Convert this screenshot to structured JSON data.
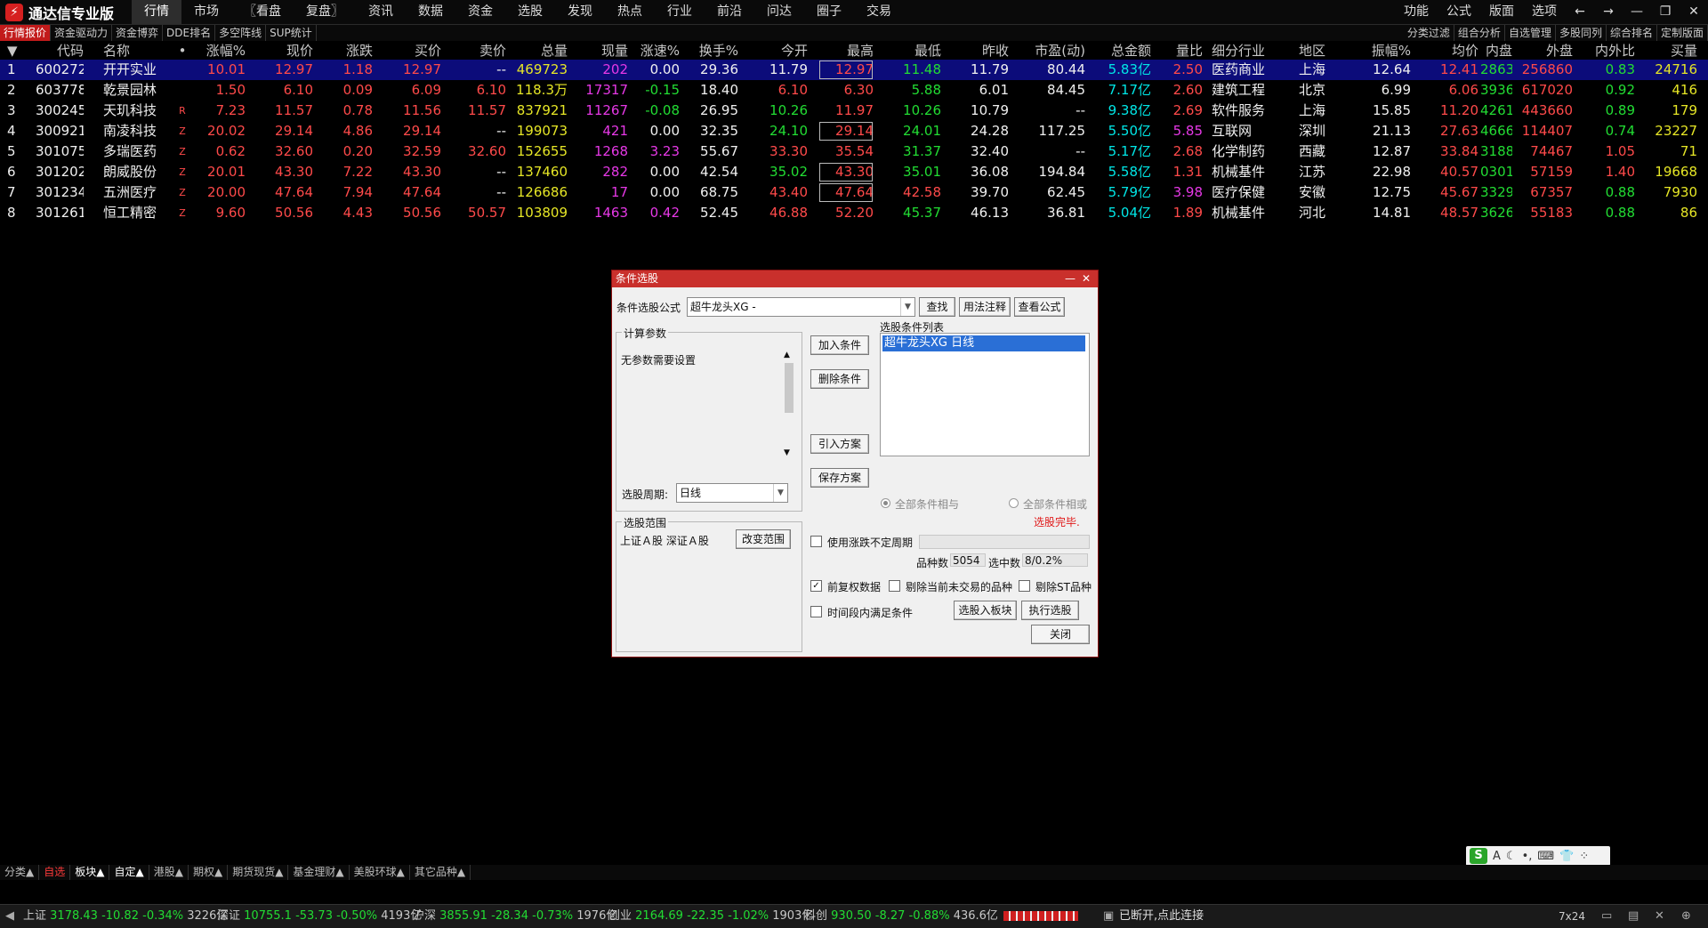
{
  "app": {
    "title": "通达信专业版",
    "menu": [
      "行情",
      "市场",
      "〖看盘",
      "复盘〗",
      "资讯",
      "数据",
      "资金",
      "选股",
      "发现",
      "热点",
      "行业",
      "前沿",
      "问达",
      "圈子",
      "交易"
    ],
    "right_menu": [
      "功能",
      "公式",
      "版面",
      "选项"
    ],
    "window_icons": [
      "back-arrow-icon",
      "forward-arrow-icon",
      "minimize-icon",
      "restore-icon",
      "close-icon"
    ]
  },
  "subtabs_left": [
    "行情报价",
    "资金驱动力",
    "资金博弈",
    "DDE排名",
    "多空阵线",
    "SUP统计"
  ],
  "subtabs_right": [
    "分类过滤",
    "组合分析",
    "自选管理",
    "多股同列",
    "综合排名",
    "定制版面"
  ],
  "table": {
    "columns": [
      "",
      "代码",
      "名称",
      "•",
      "涨幅%",
      "现价",
      "涨跌",
      "买价",
      "卖价",
      "总量",
      "现量",
      "涨速%",
      "换手%",
      "今开",
      "最高",
      "最低",
      "昨收",
      "市盈(动)",
      "总金额",
      "量比",
      "细分行业",
      "地区",
      "振幅%",
      "均价",
      "内盘",
      "外盘",
      "内外比",
      "买量"
    ],
    "rows": [
      [
        "1",
        "600272",
        "开开实业",
        "",
        "10.01",
        "12.97",
        "1.18",
        "12.97",
        "--",
        "469723",
        "202",
        "0.00",
        "29.36",
        "11.79",
        "12.97",
        "11.48",
        "11.79",
        "80.44",
        "5.83亿",
        "2.50",
        "医药商业",
        "上海",
        "12.64",
        "12.41",
        "2863",
        "256860",
        "0.83",
        "24716"
      ],
      [
        "2",
        "603778",
        "乾景园林",
        "",
        "1.50",
        "6.10",
        "0.09",
        "6.09",
        "6.10",
        "118.3万",
        "17317",
        "-0.15",
        "18.40",
        "6.10",
        "6.30",
        "5.88",
        "6.01",
        "84.45",
        "7.17亿",
        "2.60",
        "建筑工程",
        "北京",
        "6.99",
        "6.06",
        "3936",
        "617020",
        "0.92",
        "416"
      ],
      [
        "3",
        "300245",
        "天玑科技",
        "R",
        "7.23",
        "11.57",
        "0.78",
        "11.56",
        "11.57",
        "837921",
        "11267",
        "-0.08",
        "26.95",
        "10.26",
        "11.97",
        "10.26",
        "10.79",
        "--",
        "9.38亿",
        "2.69",
        "软件服务",
        "上海",
        "15.85",
        "11.20",
        "4261",
        "443660",
        "0.89",
        "179"
      ],
      [
        "4",
        "300921",
        "南凌科技",
        "Z",
        "20.02",
        "29.14",
        "4.86",
        "29.14",
        "--",
        "199073",
        "421",
        "0.00",
        "32.35",
        "24.10",
        "29.14",
        "24.01",
        "24.28",
        "117.25",
        "5.50亿",
        "5.85",
        "互联网",
        "深圳",
        "21.13",
        "27.63",
        "4666",
        "114407",
        "0.74",
        "23227"
      ],
      [
        "5",
        "301075",
        "多瑞医药",
        "Z",
        "0.62",
        "32.60",
        "0.20",
        "32.59",
        "32.60",
        "152655",
        "1268",
        "3.23",
        "55.67",
        "33.30",
        "35.54",
        "31.37",
        "32.40",
        "--",
        "5.17亿",
        "2.68",
        "化学制药",
        "西藏",
        "12.87",
        "33.84",
        "3188",
        "74467",
        "1.05",
        "71"
      ],
      [
        "6",
        "301202",
        "朗威股份",
        "Z",
        "20.01",
        "43.30",
        "7.22",
        "43.30",
        "--",
        "137460",
        "282",
        "0.00",
        "42.54",
        "35.02",
        "43.30",
        "35.01",
        "36.08",
        "194.84",
        "5.58亿",
        "1.31",
        "机械基件",
        "江苏",
        "22.98",
        "40.57",
        "0301",
        "57159",
        "1.40",
        "19668"
      ],
      [
        "7",
        "301234",
        "五洲医疗",
        "Z",
        "20.00",
        "47.64",
        "7.94",
        "47.64",
        "--",
        "126686",
        "17",
        "0.00",
        "68.75",
        "43.40",
        "47.64",
        "42.58",
        "39.70",
        "62.45",
        "5.79亿",
        "3.98",
        "医疗保健",
        "安徽",
        "12.75",
        "45.67",
        "3329",
        "67357",
        "0.88",
        "7930"
      ],
      [
        "8",
        "301261",
        "恒工精密",
        "Z",
        "9.60",
        "50.56",
        "4.43",
        "50.56",
        "50.57",
        "103809",
        "1463",
        "0.42",
        "52.45",
        "46.88",
        "52.20",
        "45.37",
        "46.13",
        "36.81",
        "5.04亿",
        "1.89",
        "机械基件",
        "河北",
        "14.81",
        "48.57",
        "3626",
        "55183",
        "0.88",
        "86"
      ]
    ]
  },
  "bottom_tabs": [
    "分类▲",
    "自选",
    "板块▲",
    "自定▲",
    "港股▲",
    "期权▲",
    "期货现货▲",
    "基金理财▲",
    "美股环球▲",
    "其它品种▲"
  ],
  "status": {
    "sh_label": "上证",
    "sh_val": "3178.43",
    "sh_chg": "-10.82",
    "sh_pct": "-0.34%",
    "sh_amt": "3226亿",
    "sz_label": "深证",
    "sz_val": "10755.1",
    "sz_chg": "-53.73",
    "sz_pct": "-0.50%",
    "sz_amt": "4193亿",
    "hs_label": "沪深",
    "hs_val": "3855.91",
    "hs_chg": "-28.34",
    "hs_pct": "-0.73%",
    "hs_amt": "1976亿",
    "cy_label": "创业",
    "cy_val": "2164.69",
    "cy_chg": "-22.35",
    "cy_pct": "-1.02%",
    "cy_amt": "1903亿",
    "kc_label": "科创",
    "kc_val": "930.50",
    "kc_chg": "-8.27",
    "kc_pct": "-0.88%",
    "kc_amt": "436.6亿",
    "conn": "已断开,点此连接",
    "clock": "7x24"
  },
  "ime": {
    "s": "S",
    "a": "A"
  },
  "dialog": {
    "title": "条件选股",
    "formula_label": "条件选股公式",
    "formula_value": "超牛龙头XG   -",
    "btn_find": "查找",
    "btn_usage": "用法注释",
    "btn_view": "查看公式",
    "calc_legend": "计算参数",
    "calc_text": "无参数需要设置",
    "period_label": "选股周期:",
    "period_value": "日线",
    "btn_add": "加入条件",
    "btn_delete": "删除条件",
    "btn_import": "引入方案",
    "btn_save": "保存方案",
    "cond_list_label": "选股条件列表",
    "cond_item": "超牛龙头XG  日线",
    "radio_and": "全部条件相与",
    "radio_or": "全部条件相或",
    "done": "选股完毕.",
    "range_legend": "选股范围",
    "range_value": "上证Ａ股 深证Ａ股",
    "btn_range": "改变范围",
    "chk_period": "使用涨跌不定周期",
    "count_label": "品种数",
    "count_value": "5054",
    "selected_label": "选中数",
    "selected_value": "8/0.2%",
    "chk_restore": "前复权数据",
    "chk_notrade": "剔除当前未交易的品种",
    "chk_st": "剔除ST品种",
    "chk_time": "时间段内满足条件",
    "btn_to_block": "选股入板块",
    "btn_execute": "执行选股",
    "btn_close": "关闭",
    "checked_restore": true
  }
}
